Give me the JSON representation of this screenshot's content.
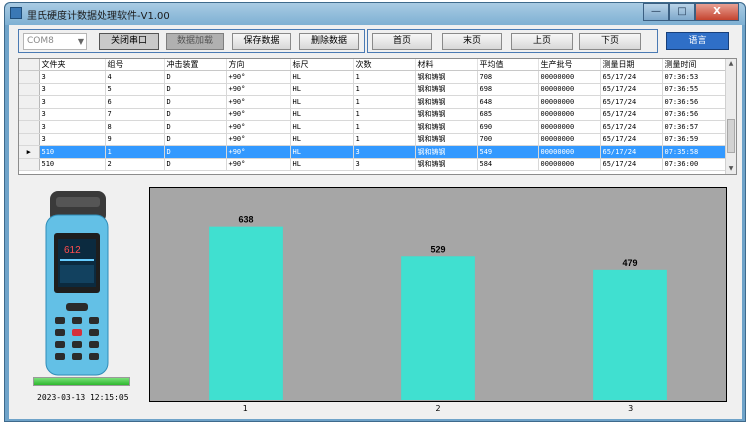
{
  "window": {
    "title": "里氏硬度计数据处理软件-V1.00",
    "controls": {
      "minimize": "—",
      "maximize": "□",
      "close": "X"
    }
  },
  "toolbar": {
    "port_value": "COM8",
    "close_port": "关闭串口",
    "load_data": "数据加载",
    "save_data": "保存数据",
    "delete_data": "删除数据",
    "first_page": "首页",
    "last_page": "末页",
    "prev_page": "上页",
    "next_page": "下页",
    "language": "语言"
  },
  "table": {
    "columns": [
      "文件夹",
      "组号",
      "冲击装置",
      "方向",
      "标尺",
      "次数",
      "材料",
      "平均值",
      "生产批号",
      "测量日期",
      "测量时间"
    ],
    "rows": [
      [
        "3",
        "4",
        "D",
        "+90°",
        "HL",
        "1",
        "钢和铸钢",
        "708",
        "00000000",
        "65/17/24",
        "07:36:53"
      ],
      [
        "3",
        "5",
        "D",
        "+90°",
        "HL",
        "1",
        "钢和铸钢",
        "698",
        "00000000",
        "65/17/24",
        "07:36:55"
      ],
      [
        "3",
        "6",
        "D",
        "+90°",
        "HL",
        "1",
        "钢和铸钢",
        "648",
        "00000000",
        "65/17/24",
        "07:36:56"
      ],
      [
        "3",
        "7",
        "D",
        "+90°",
        "HL",
        "1",
        "钢和铸钢",
        "685",
        "00000000",
        "65/17/24",
        "07:36:56"
      ],
      [
        "3",
        "8",
        "D",
        "+90°",
        "HL",
        "1",
        "钢和铸钢",
        "690",
        "00000000",
        "65/17/24",
        "07:36:57"
      ],
      [
        "3",
        "9",
        "D",
        "+90°",
        "HL",
        "1",
        "钢和铸钢",
        "700",
        "00000000",
        "65/17/24",
        "07:36:59"
      ],
      [
        "510",
        "1",
        "D",
        "+90°",
        "HL",
        "3",
        "钢和铸钢",
        "549",
        "00000000",
        "65/17/24",
        "07:35:58"
      ],
      [
        "510",
        "2",
        "D",
        "+90°",
        "HL",
        "3",
        "钢和铸钢",
        "584",
        "00000000",
        "65/17/24",
        "07:36:00"
      ]
    ],
    "selected_row": 6
  },
  "device": {
    "screen_value": "612"
  },
  "status": {
    "progress": 1.0,
    "datetime": "2023-03-13 12:15:05"
  },
  "colors": {
    "bar": "#40e0d0",
    "chart_bg": "#a6a6a6",
    "selection": "#3399ff",
    "language_button": "#2f6fc7"
  },
  "chart_data": {
    "type": "bar",
    "categories": [
      "1",
      "2",
      "3"
    ],
    "values": [
      638,
      529,
      479
    ],
    "ylim": [
      0,
      700
    ],
    "grid": false,
    "title": "",
    "xlabel": "",
    "ylabel": ""
  }
}
